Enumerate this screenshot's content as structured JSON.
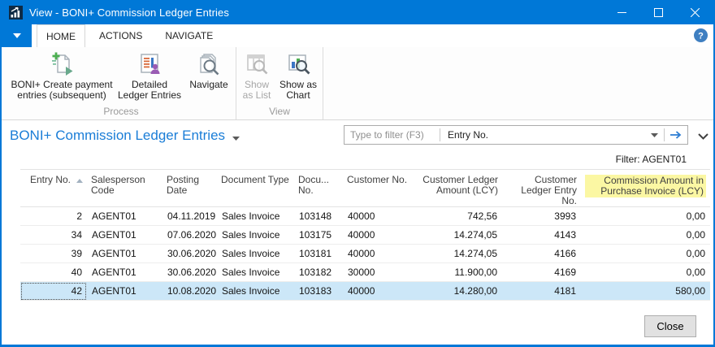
{
  "window": {
    "title": "View - BONI+ Commission Ledger Entries",
    "controls": [
      "minimize",
      "maximize",
      "close"
    ]
  },
  "tabs": [
    {
      "label": "HOME",
      "active": true
    },
    {
      "label": "ACTIONS",
      "active": false
    },
    {
      "label": "NAVIGATE",
      "active": false
    }
  ],
  "ribbon": {
    "groups": [
      {
        "label": "Process",
        "buttons": [
          {
            "label": "BONI+ Create payment entries (subsequent)",
            "icon": "create-payment-entries-icon",
            "enabled": true
          },
          {
            "label": "Detailed Ledger Entries",
            "icon": "detailed-ledger-entries-icon",
            "enabled": true
          },
          {
            "label": "Navigate",
            "icon": "navigate-icon",
            "enabled": true
          }
        ]
      },
      {
        "label": "View",
        "buttons": [
          {
            "label": "Show as List",
            "icon": "show-as-list-icon",
            "enabled": false
          },
          {
            "label": "Show as Chart",
            "icon": "show-as-chart-icon",
            "enabled": true
          }
        ]
      }
    ]
  },
  "page": {
    "title": "BONI+ Commission Ledger Entries",
    "filter_placeholder": "Type to filter (F3)",
    "filter_field": "Entry No.",
    "filter_status": "Filter: AGENT01"
  },
  "table": {
    "columns": [
      "Entry No.",
      "Salesperson Code",
      "Posting Date",
      "Document Type",
      "Docu... No.",
      "Customer No.",
      "Customer Ledger Amount (LCY)",
      "Customer Ledger Entry No.",
      "Commission Amount in Purchase Invoice (LCY)"
    ],
    "sorted_by": "Entry No.",
    "sort_direction": "ascending",
    "highlighted_column": "Commission Amount in Purchase Invoice (LCY)",
    "rows": [
      [
        "2",
        "AGENT01",
        "04.11.2019",
        "Sales Invoice",
        "103148",
        "40000",
        "742,56",
        "3993",
        "0,00"
      ],
      [
        "34",
        "AGENT01",
        "07.06.2020",
        "Sales Invoice",
        "103175",
        "40000",
        "14.274,05",
        "4143",
        "0,00"
      ],
      [
        "39",
        "AGENT01",
        "30.06.2020",
        "Sales Invoice",
        "103181",
        "40000",
        "14.274,05",
        "4166",
        "0,00"
      ],
      [
        "40",
        "AGENT01",
        "30.06.2020",
        "Sales Invoice",
        "103182",
        "30000",
        "11.900,00",
        "4169",
        "0,00"
      ],
      [
        "42",
        "AGENT01",
        "10.08.2020",
        "Sales Invoice",
        "103183",
        "40000",
        "14.280,00",
        "4181",
        "580,00"
      ]
    ],
    "selected_row_index": 4
  },
  "footer": {
    "close_label": "Close"
  },
  "colors": {
    "accent": "#0078d7",
    "page_title": "#1a7dd7",
    "selected_row": "#cce7f8",
    "header_highlight": "#fbf7a3"
  }
}
